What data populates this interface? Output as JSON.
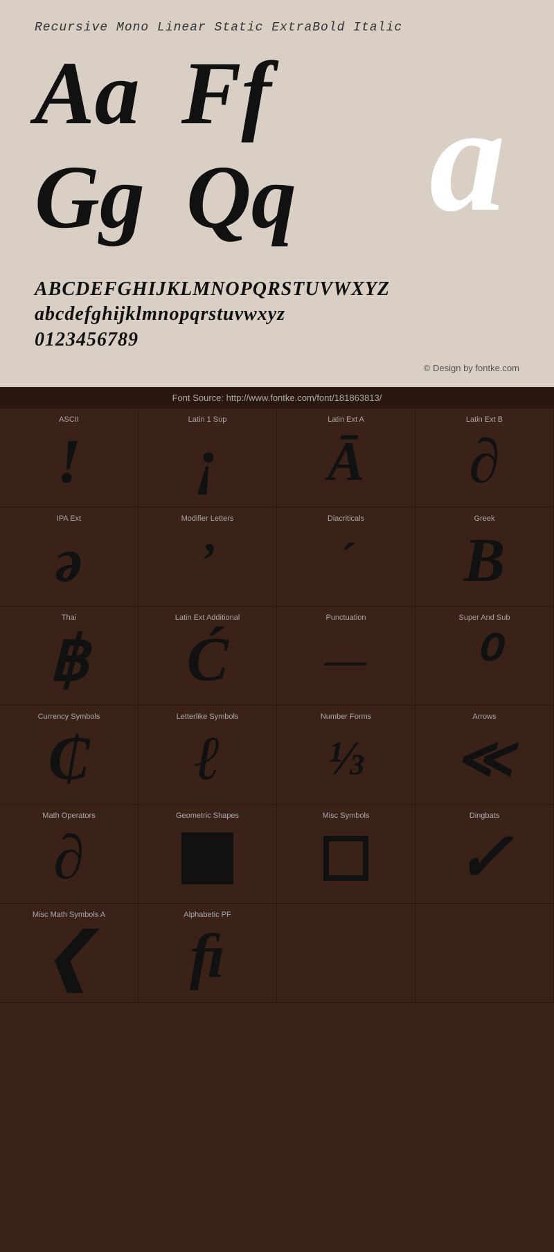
{
  "fontTitle": "Recursive Mono Linear Static ExtraBold Italic",
  "letterShowcase": {
    "pairs": [
      {
        "text": "Aa",
        "size": "large"
      },
      {
        "text": "Ff",
        "size": "large"
      },
      {
        "text": "a",
        "size": "hero"
      },
      {
        "text": "Gg",
        "size": "large"
      },
      {
        "text": "Qq",
        "size": "large"
      }
    ]
  },
  "alphabetLines": [
    "ABCDEFGHIJKLMNOPQRSTUVWXYZ",
    "abcdefghijklmnopqrstuvwxyz",
    "0123456789"
  ],
  "copyright": "© Design by fontke.com",
  "fontSource": "Font Source: http://www.fontke.com/font/181863813/",
  "glyphSections": [
    {
      "label": "ASCII",
      "char": "!"
    },
    {
      "label": "Latin 1 Sup",
      "char": "¡"
    },
    {
      "label": "Latin Ext A",
      "char": "Ā"
    },
    {
      "label": "Latin Ext B",
      "char": "ƍ"
    },
    {
      "label": "IPA Ext",
      "char": "ə"
    },
    {
      "label": "Modifier Letters",
      "char": "ʼ"
    },
    {
      "label": "Diacriticals",
      "char": "ˊ"
    },
    {
      "label": "Greek",
      "char": "Β"
    },
    {
      "label": "Thai",
      "char": "฿"
    },
    {
      "label": "Latin Ext Additional",
      "char": "Ć"
    },
    {
      "label": "Punctuation",
      "char": "—"
    },
    {
      "label": "Super And Sub",
      "char": "⁰"
    },
    {
      "label": "Currency Symbols",
      "char": "₵"
    },
    {
      "label": "Letterlike Symbols",
      "char": "ℓ"
    },
    {
      "label": "Number Forms",
      "char": "⅓",
      "type": "fraction"
    },
    {
      "label": "Arrows",
      "char": "≪",
      "type": "arrow"
    },
    {
      "label": "Math Operators",
      "char": "∂"
    },
    {
      "label": "Geometric Shapes",
      "type": "geo-square"
    },
    {
      "label": "Misc Symbols",
      "type": "rect-outline"
    },
    {
      "label": "Dingbats",
      "char": "✓",
      "type": "check"
    },
    {
      "label": "Misc Math Symbols A",
      "char": "❮"
    },
    {
      "label": "Alphabetic PF",
      "char": "ﬁ"
    }
  ]
}
